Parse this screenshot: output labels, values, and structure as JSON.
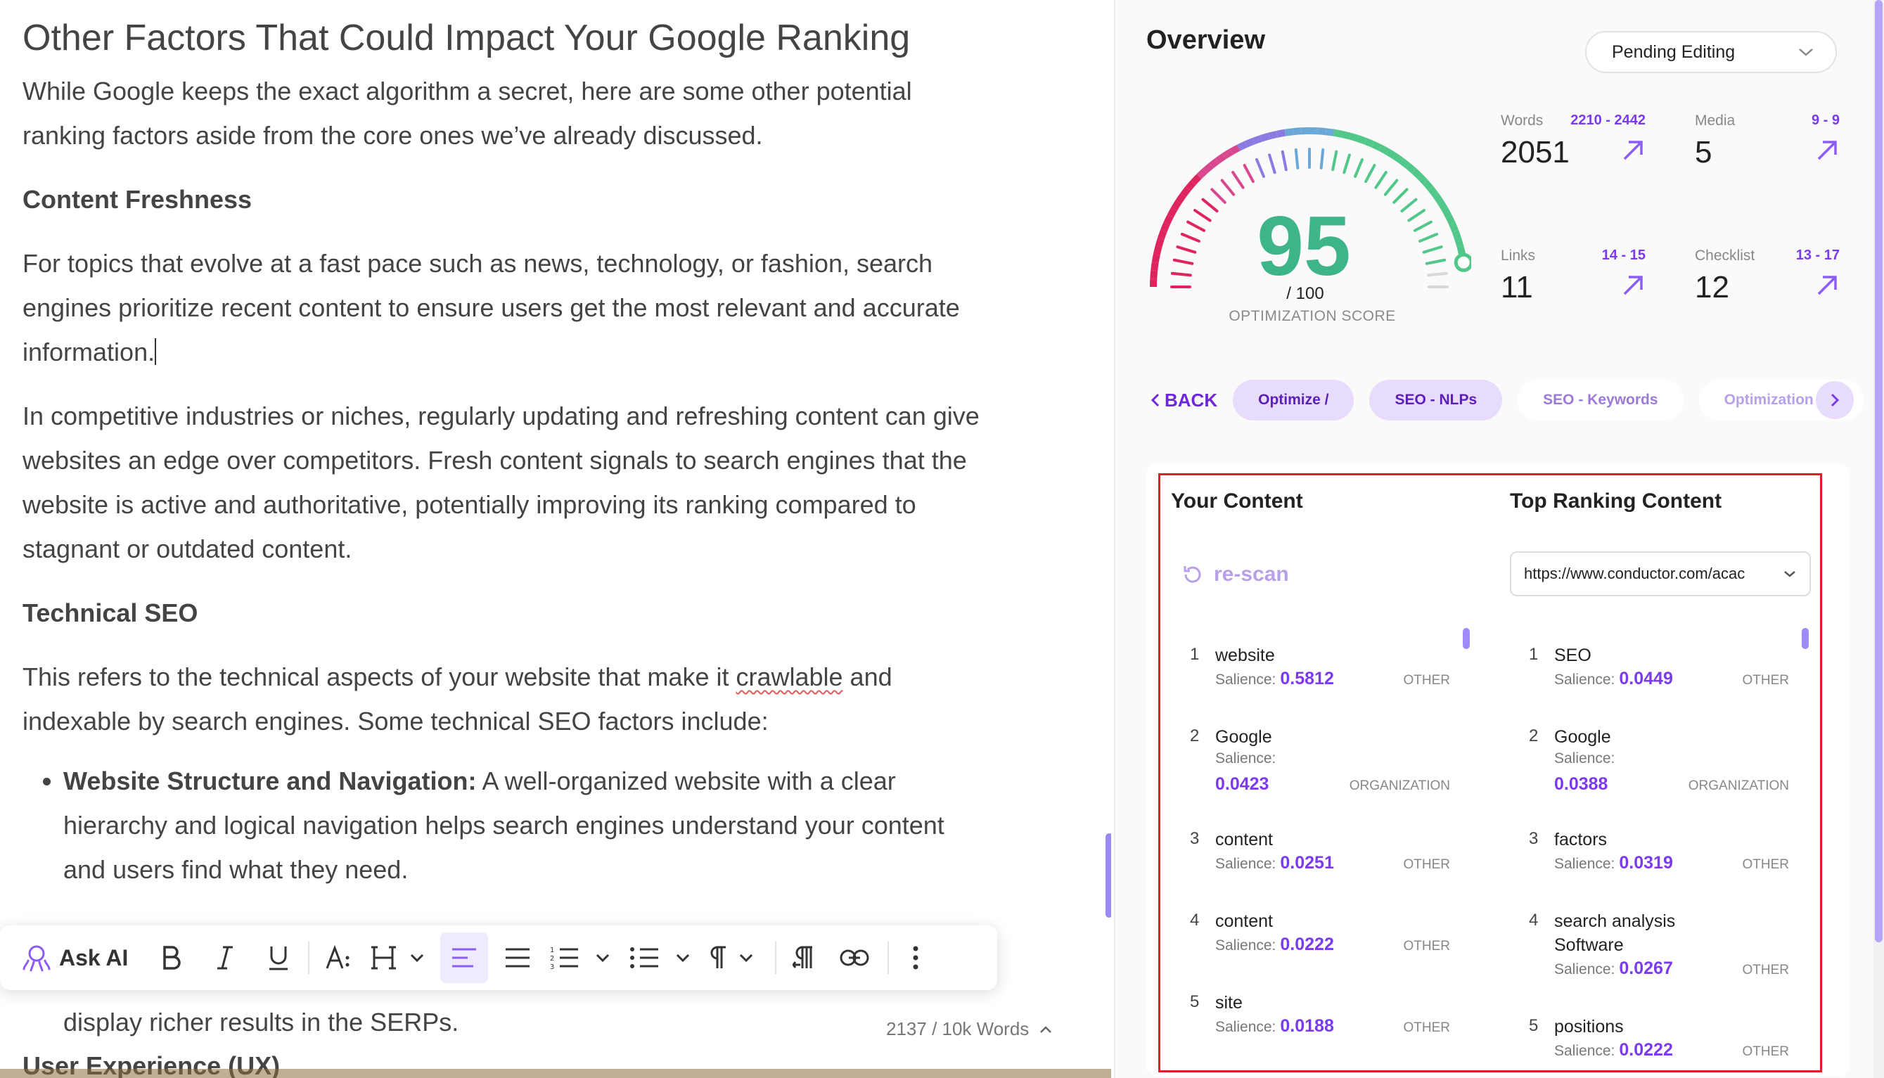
{
  "editor": {
    "title": "Other Factors That Could Impact Your Google Ranking",
    "intro": "While Google keeps the exact algorithm a secret, here are some other potential ranking factors aside from the core ones we’ve already discussed.",
    "h_freshness": "Content Freshness",
    "p_freshness1": "For topics that evolve at a fast pace such as news, technology, or fashion, search engines prioritize recent content to ensure users get the most relevant and accurate information.",
    "p_freshness2": "In competitive industries or niches, regularly updating and refreshing content can give websites an edge over competitors. Fresh content signals to search engines that the website is active and authoritative, potentially improving its ranking compared to stagnant or outdated content.",
    "h_technical": "Technical SEO",
    "p_technical_a": "This refers to the technical aspects of your website that make it ",
    "p_technical_squiggle": "crawlable",
    "p_technical_b": " and indexable by search engines. Some technical SEO factors include:",
    "bullet1_bold": "Website Structure and Navigation:",
    "bullet1_text": " A well-organized website with a clear hierarchy and logical navigation helps search engines understand your content and users find what they need.",
    "bullet2_tail": "display richer results in the SERPs.",
    "h_ux": "User Experience (UX)",
    "word_count": "2137 / 10k Words",
    "toolbar": {
      "ask_ai": "Ask AI"
    }
  },
  "panel": {
    "title": "Overview",
    "status": "Pending Editing",
    "score": {
      "value": "95",
      "denominator": "/ 100",
      "label": "OPTIMIZATION SCORE",
      "fraction": 0.95
    },
    "stats": [
      {
        "label": "Words",
        "range": "2210 - 2442",
        "value": "2051"
      },
      {
        "label": "Media",
        "range": "9 - 9",
        "value": "5"
      },
      {
        "label": "Links",
        "range": "14 - 15",
        "value": "11"
      },
      {
        "label": "Checklist",
        "range": "13 - 17",
        "value": "12"
      }
    ],
    "back": "BACK",
    "tabs": [
      "Optimize /",
      "SEO - NLPs",
      "SEO - Keywords",
      "Optimization /"
    ],
    "your_content": {
      "title": "Your Content",
      "rescan": "re-scan",
      "items": [
        {
          "num": "1",
          "term": "website",
          "salience": "0.5812",
          "category": "OTHER"
        },
        {
          "num": "2",
          "term": "Google",
          "salience": "0.0423",
          "category": "ORGANIZATION"
        },
        {
          "num": "3",
          "term": "content",
          "salience": "0.0251",
          "category": "OTHER"
        },
        {
          "num": "4",
          "term": "content",
          "salience": "0.0222",
          "category": "OTHER"
        },
        {
          "num": "5",
          "term": "site",
          "salience": "0.0188",
          "category": "OTHER"
        }
      ]
    },
    "top_ranking": {
      "title": "Top Ranking Content",
      "url": "https://www.conductor.com/acac",
      "items": [
        {
          "num": "1",
          "term": "SEO",
          "salience": "0.0449",
          "category": "OTHER"
        },
        {
          "num": "2",
          "term": "Google",
          "salience": "0.0388",
          "category": "ORGANIZATION"
        },
        {
          "num": "3",
          "term": "factors",
          "salience": "0.0319",
          "category": "OTHER"
        },
        {
          "num": "4",
          "term": "search analysis Software",
          "salience": "0.0267",
          "category": "OTHER"
        },
        {
          "num": "5",
          "term": "positions",
          "salience": "0.0222",
          "category": "OTHER"
        }
      ]
    },
    "salience_label": "Salience:",
    "colors": {
      "accent": "#7c3aed",
      "score": "#3eb489",
      "frame": "#e11d2a"
    }
  }
}
